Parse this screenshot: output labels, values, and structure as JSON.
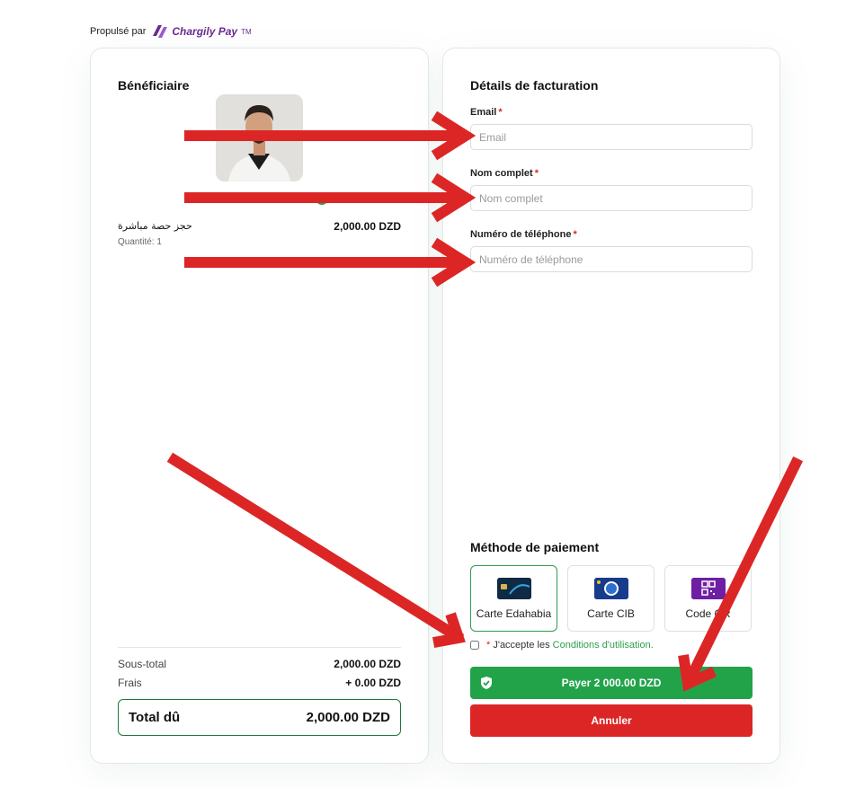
{
  "powered_by": {
    "prefix": "Propulsé par",
    "brand": "Chargily Pay",
    "tm": "TM"
  },
  "beneficiary": {
    "title": "Bénéficiaire",
    "name": "",
    "item": {
      "name": "حجز حصة مباشرة",
      "quantity": "Quantité: 1",
      "price": "2,000.00 DZD"
    }
  },
  "summary": {
    "subtotal_label": "Sous-total",
    "subtotal_value": "2,000.00 DZD",
    "fees_label": "Frais",
    "fees_value": "+ 0.00 DZD",
    "total_label": "Total dû",
    "total_value": "2,000.00 DZD"
  },
  "billing": {
    "title": "Détails de facturation",
    "email_label": "Email",
    "email_placeholder": "Email",
    "email_value": "",
    "name_label": "Nom complet",
    "name_placeholder": "Nom complet",
    "name_value": "",
    "phone_label": "Numéro de téléphone",
    "phone_placeholder": "Numéro de téléphone",
    "phone_value": "",
    "required_mark": "*"
  },
  "payment": {
    "title": "Méthode de paiement",
    "methods": [
      {
        "label": "Carte Edahabia",
        "icon": "edahabia-card-icon",
        "selected": true
      },
      {
        "label": "Carte CIB",
        "icon": "cib-card-icon",
        "selected": false
      },
      {
        "label": "Code QR",
        "icon": "qr-code-icon",
        "selected": false
      }
    ],
    "terms_mark": "*",
    "terms_prefix": "J'accepte les",
    "terms_link": "Conditions d'utilisation.",
    "pay_label": "Payer 2 000.00 DZD",
    "cancel_label": "Annuler"
  },
  "colors": {
    "accent_green": "#22a34a",
    "cancel_red": "#dc2626",
    "brand_purple": "#6b2c91",
    "arrow_red": "#dc2626"
  }
}
